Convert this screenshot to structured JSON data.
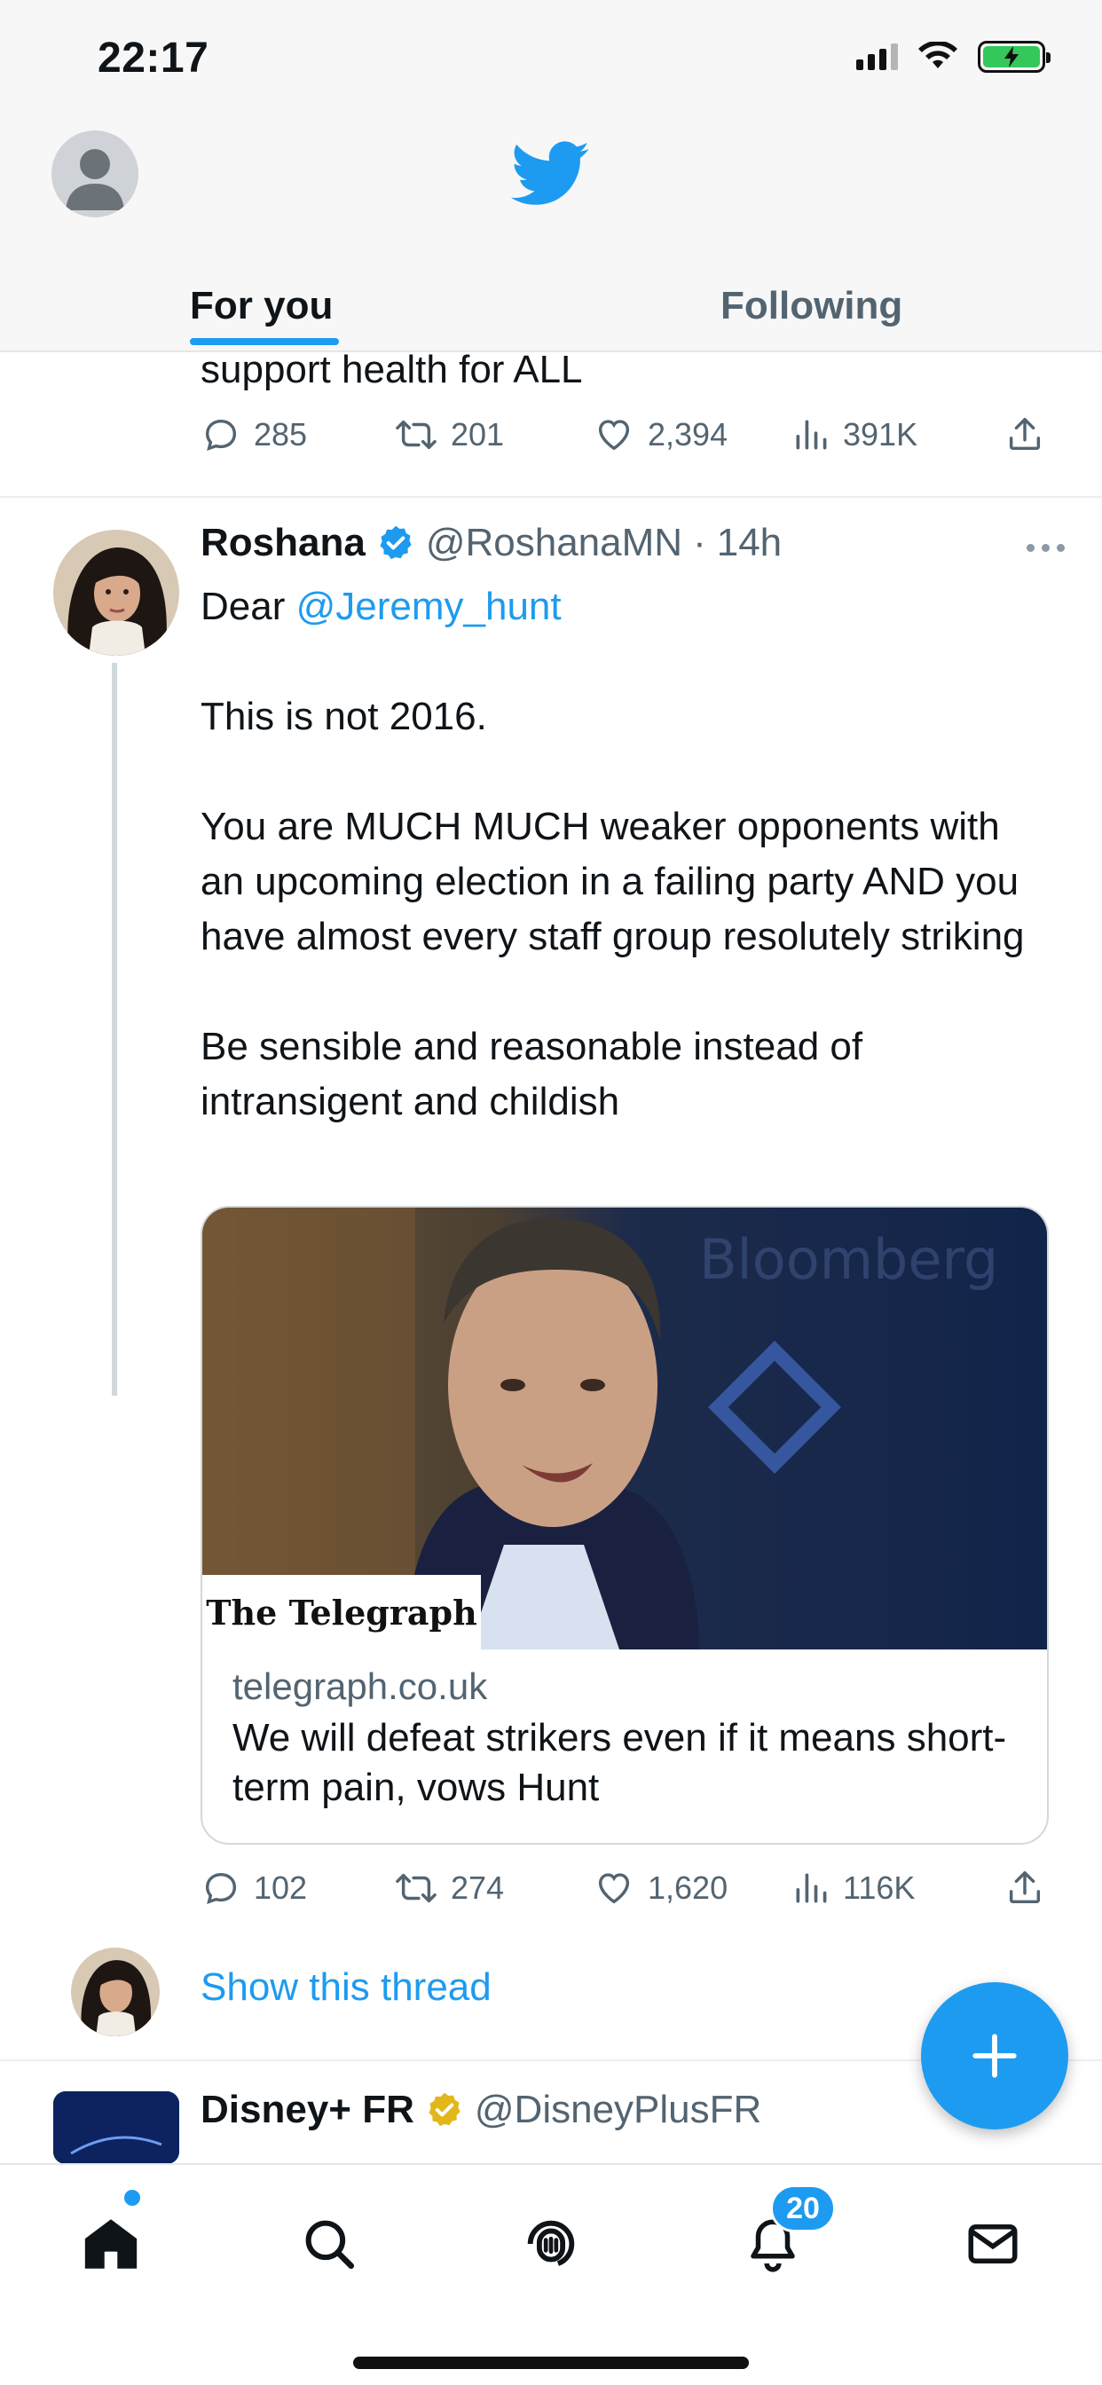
{
  "status_bar": {
    "time": "22:17"
  },
  "header": {
    "tabs": [
      {
        "label": "For you",
        "active": true
      },
      {
        "label": "Following",
        "active": false
      }
    ]
  },
  "feed": {
    "previous_tweet": {
      "text_tail": "support health for ALL",
      "replies": "285",
      "retweets": "201",
      "likes": "2,394",
      "views": "391K"
    },
    "tweet": {
      "name": "Roshana",
      "verified": true,
      "handle": "@RoshanaMN",
      "separator": "·",
      "time": "14h",
      "text_prefix": "Dear ",
      "mention": "@Jeremy_hunt",
      "paragraph1": "This is not 2016.",
      "paragraph2": "You are MUCH MUCH weaker opponents with an upcoming election in a failing party AND you have almost every staff group resolutely striking",
      "paragraph3": "Be sensible and reasonable instead of intransigent and childish",
      "card": {
        "brand": "The Telegraph",
        "domain": "telegraph.co.uk",
        "title": "We will defeat strikers even if it means short-term pain, vows Hunt"
      },
      "replies": "102",
      "retweets": "274",
      "likes": "1,620",
      "views": "116K"
    },
    "show_thread": "Show this thread",
    "next_tweet": {
      "name": "Disney+ FR",
      "verified": true,
      "handle": "@DisneyPlusFR"
    }
  },
  "tab_bar": {
    "notifications_badge": "20"
  },
  "colors": {
    "accent": "#1d9bf0",
    "text_secondary": "#536471",
    "gold_badge": "#e2b719"
  }
}
